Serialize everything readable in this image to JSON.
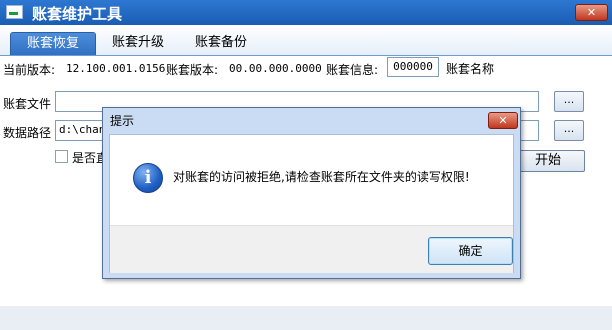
{
  "window": {
    "title": "账套维护工具",
    "close_label": "✕"
  },
  "tabs": [
    {
      "label": "账套恢复",
      "active": true
    },
    {
      "label": "账套升级",
      "active": false
    },
    {
      "label": "账套备份",
      "active": false
    }
  ],
  "info": {
    "current_version_label": "当前版本:",
    "current_version_value": "12.100.001.0156",
    "account_version_label": "账套版本:",
    "account_version_value": "00.00.000.0000",
    "account_info_label": "账套信息:",
    "account_info_value": "000000",
    "account_name_label": "账套名称"
  },
  "form": {
    "account_file_label": "账套文件",
    "account_file_value": "",
    "data_path_label": "数据路径",
    "data_path_value": "d:\\chan",
    "browse_label": "...",
    "checkbox_label": "是否直",
    "start_label": "开始"
  },
  "dialog": {
    "title": "提示",
    "close_label": "✕",
    "icon": "info-icon",
    "message": "对账套的访问被拒绝,请检查账套所在文件夹的读写权限!",
    "ok_label": "确定"
  },
  "colors": {
    "titlebar": "#1a5cb3",
    "tab_active": "#3a7acb",
    "dialog_frame": "#c9dcf3",
    "close_button": "#c1361d"
  }
}
